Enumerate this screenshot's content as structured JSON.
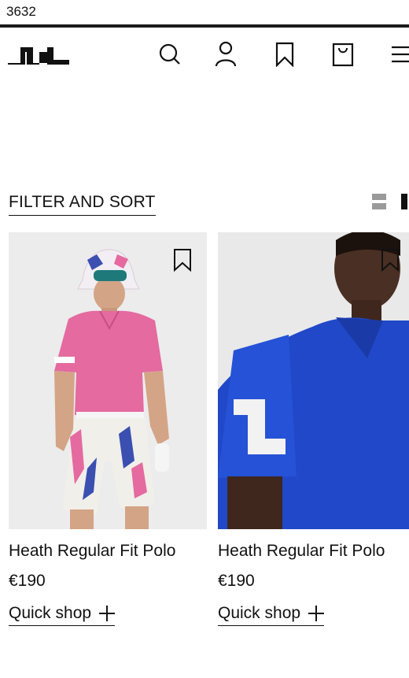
{
  "status": {
    "code": "3632"
  },
  "header": {
    "logo_icon": "jl-logo-icon",
    "icons": [
      "search-icon",
      "account-icon",
      "wishlist-icon",
      "bag-icon",
      "menu-icon"
    ]
  },
  "toolbar": {
    "filter_label": "FILTER AND SORT",
    "view_options": [
      "two-column-grid-icon",
      "single-column-grid-icon"
    ]
  },
  "products": [
    {
      "name": "Heath Regular Fit Polo",
      "price": "€190",
      "quick_shop": "Quick shop",
      "color": "#e46aa0"
    },
    {
      "name": "Heath Regular Fit Polo",
      "price": "€190",
      "quick_shop": "Quick shop",
      "color": "#2048c8"
    }
  ]
}
